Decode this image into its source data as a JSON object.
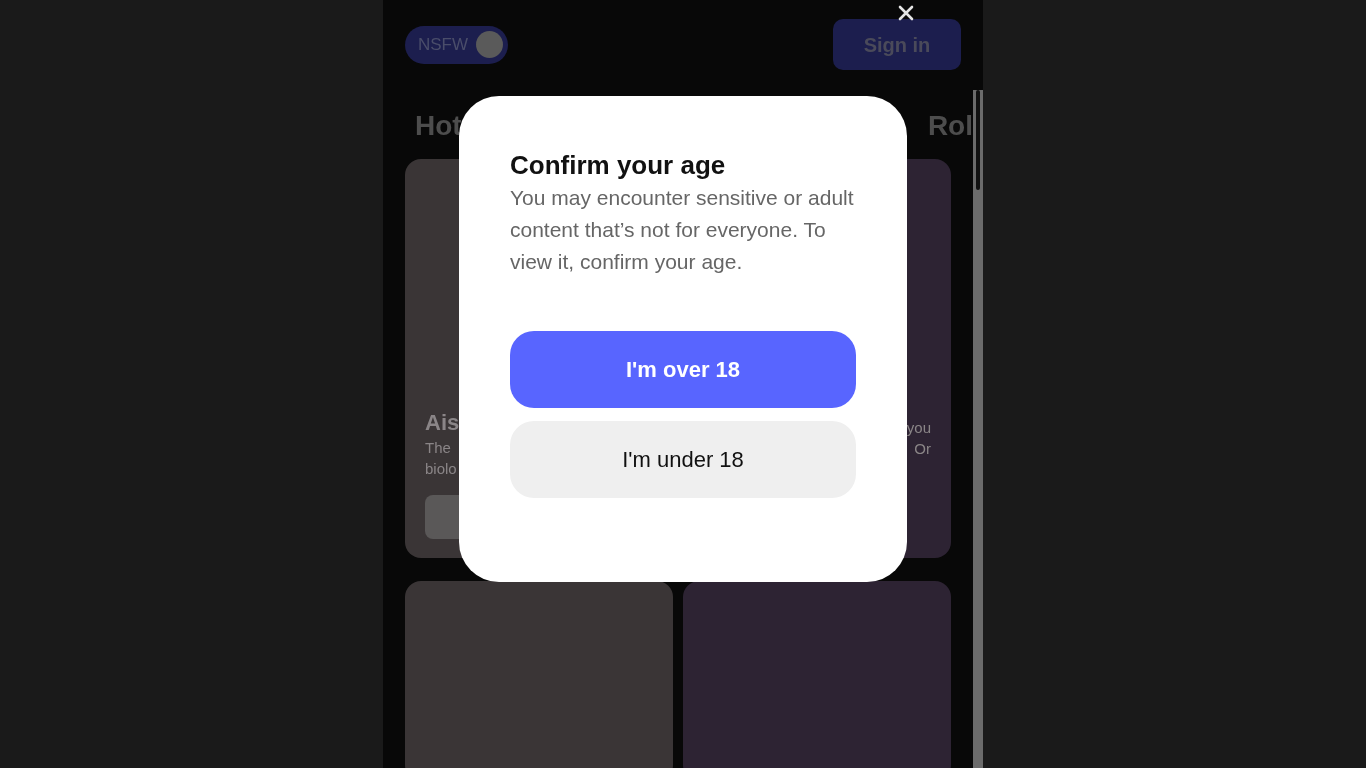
{
  "header": {
    "nsfw_toggle": {
      "label": "NSFW",
      "on": true
    },
    "sign_in": "Sign in"
  },
  "tabs": [
    {
      "label": "Hot"
    },
    {
      "label": "Rol"
    }
  ],
  "cards": [
    {
      "kind": "character",
      "title": "Ais",
      "description_lines": [
        "The",
        "biolo"
      ]
    },
    {
      "kind": "character",
      "description_lines": [
        "you",
        "Or"
      ]
    },
    {
      "kind": "character"
    },
    {
      "kind": "character"
    }
  ],
  "dialog": {
    "title": "Confirm your age",
    "body": "You may encounter sensitive or adult content that’s not for everyone. To view it, confirm your age.",
    "buttons": [
      {
        "label": "I'm over 18",
        "kind": "primary"
      },
      {
        "label": "I'm under 18",
        "kind": "secondary"
      }
    ]
  }
}
